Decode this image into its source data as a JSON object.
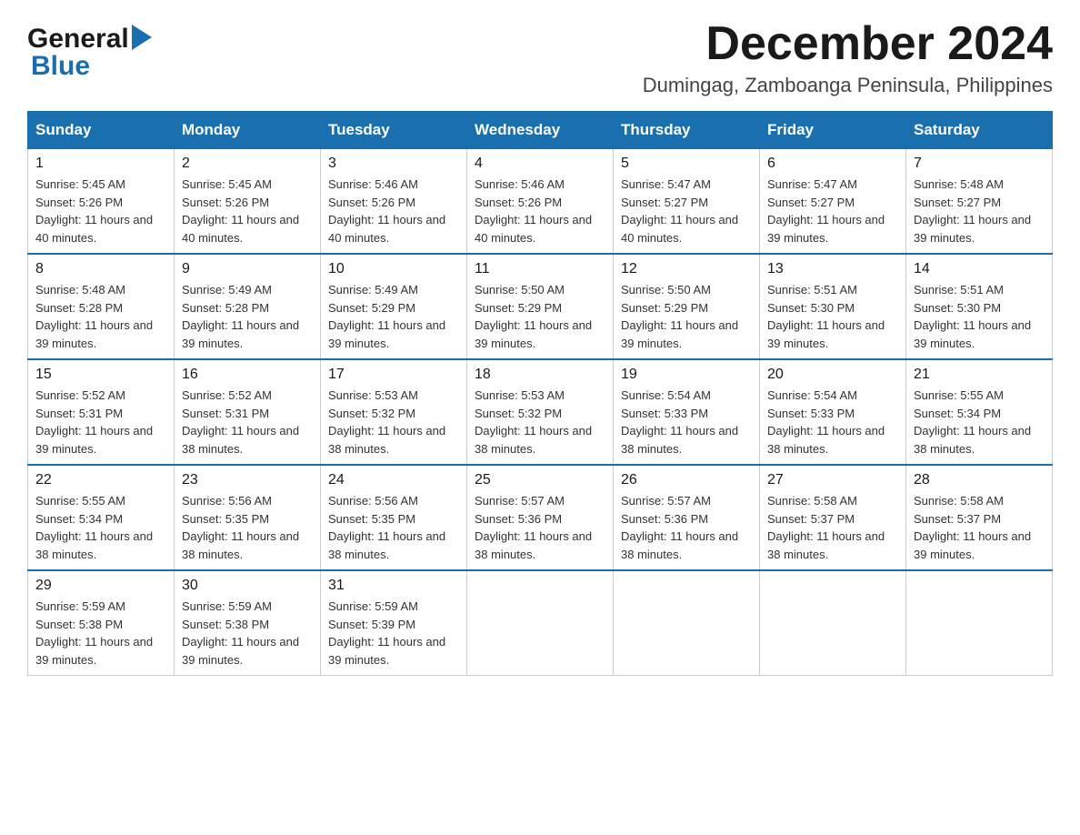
{
  "header": {
    "logo_text_general": "General",
    "logo_text_blue": "Blue",
    "title": "December 2024",
    "subtitle": "Dumingag, Zamboanga Peninsula, Philippines"
  },
  "calendar": {
    "days_of_week": [
      "Sunday",
      "Monday",
      "Tuesday",
      "Wednesday",
      "Thursday",
      "Friday",
      "Saturday"
    ],
    "weeks": [
      [
        {
          "day": "1",
          "sunrise": "5:45 AM",
          "sunset": "5:26 PM",
          "daylight": "11 hours and 40 minutes."
        },
        {
          "day": "2",
          "sunrise": "5:45 AM",
          "sunset": "5:26 PM",
          "daylight": "11 hours and 40 minutes."
        },
        {
          "day": "3",
          "sunrise": "5:46 AM",
          "sunset": "5:26 PM",
          "daylight": "11 hours and 40 minutes."
        },
        {
          "day": "4",
          "sunrise": "5:46 AM",
          "sunset": "5:26 PM",
          "daylight": "11 hours and 40 minutes."
        },
        {
          "day": "5",
          "sunrise": "5:47 AM",
          "sunset": "5:27 PM",
          "daylight": "11 hours and 40 minutes."
        },
        {
          "day": "6",
          "sunrise": "5:47 AM",
          "sunset": "5:27 PM",
          "daylight": "11 hours and 39 minutes."
        },
        {
          "day": "7",
          "sunrise": "5:48 AM",
          "sunset": "5:27 PM",
          "daylight": "11 hours and 39 minutes."
        }
      ],
      [
        {
          "day": "8",
          "sunrise": "5:48 AM",
          "sunset": "5:28 PM",
          "daylight": "11 hours and 39 minutes."
        },
        {
          "day": "9",
          "sunrise": "5:49 AM",
          "sunset": "5:28 PM",
          "daylight": "11 hours and 39 minutes."
        },
        {
          "day": "10",
          "sunrise": "5:49 AM",
          "sunset": "5:29 PM",
          "daylight": "11 hours and 39 minutes."
        },
        {
          "day": "11",
          "sunrise": "5:50 AM",
          "sunset": "5:29 PM",
          "daylight": "11 hours and 39 minutes."
        },
        {
          "day": "12",
          "sunrise": "5:50 AM",
          "sunset": "5:29 PM",
          "daylight": "11 hours and 39 minutes."
        },
        {
          "day": "13",
          "sunrise": "5:51 AM",
          "sunset": "5:30 PM",
          "daylight": "11 hours and 39 minutes."
        },
        {
          "day": "14",
          "sunrise": "5:51 AM",
          "sunset": "5:30 PM",
          "daylight": "11 hours and 39 minutes."
        }
      ],
      [
        {
          "day": "15",
          "sunrise": "5:52 AM",
          "sunset": "5:31 PM",
          "daylight": "11 hours and 39 minutes."
        },
        {
          "day": "16",
          "sunrise": "5:52 AM",
          "sunset": "5:31 PM",
          "daylight": "11 hours and 38 minutes."
        },
        {
          "day": "17",
          "sunrise": "5:53 AM",
          "sunset": "5:32 PM",
          "daylight": "11 hours and 38 minutes."
        },
        {
          "day": "18",
          "sunrise": "5:53 AM",
          "sunset": "5:32 PM",
          "daylight": "11 hours and 38 minutes."
        },
        {
          "day": "19",
          "sunrise": "5:54 AM",
          "sunset": "5:33 PM",
          "daylight": "11 hours and 38 minutes."
        },
        {
          "day": "20",
          "sunrise": "5:54 AM",
          "sunset": "5:33 PM",
          "daylight": "11 hours and 38 minutes."
        },
        {
          "day": "21",
          "sunrise": "5:55 AM",
          "sunset": "5:34 PM",
          "daylight": "11 hours and 38 minutes."
        }
      ],
      [
        {
          "day": "22",
          "sunrise": "5:55 AM",
          "sunset": "5:34 PM",
          "daylight": "11 hours and 38 minutes."
        },
        {
          "day": "23",
          "sunrise": "5:56 AM",
          "sunset": "5:35 PM",
          "daylight": "11 hours and 38 minutes."
        },
        {
          "day": "24",
          "sunrise": "5:56 AM",
          "sunset": "5:35 PM",
          "daylight": "11 hours and 38 minutes."
        },
        {
          "day": "25",
          "sunrise": "5:57 AM",
          "sunset": "5:36 PM",
          "daylight": "11 hours and 38 minutes."
        },
        {
          "day": "26",
          "sunrise": "5:57 AM",
          "sunset": "5:36 PM",
          "daylight": "11 hours and 38 minutes."
        },
        {
          "day": "27",
          "sunrise": "5:58 AM",
          "sunset": "5:37 PM",
          "daylight": "11 hours and 38 minutes."
        },
        {
          "day": "28",
          "sunrise": "5:58 AM",
          "sunset": "5:37 PM",
          "daylight": "11 hours and 39 minutes."
        }
      ],
      [
        {
          "day": "29",
          "sunrise": "5:59 AM",
          "sunset": "5:38 PM",
          "daylight": "11 hours and 39 minutes."
        },
        {
          "day": "30",
          "sunrise": "5:59 AM",
          "sunset": "5:38 PM",
          "daylight": "11 hours and 39 minutes."
        },
        {
          "day": "31",
          "sunrise": "5:59 AM",
          "sunset": "5:39 PM",
          "daylight": "11 hours and 39 minutes."
        },
        null,
        null,
        null,
        null
      ]
    ]
  }
}
